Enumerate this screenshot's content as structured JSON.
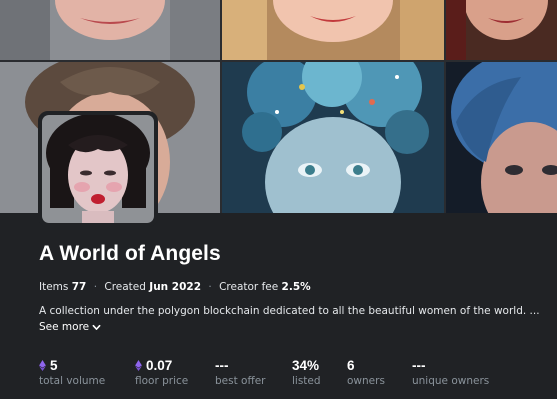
{
  "collection": {
    "title": "A World of Angels",
    "meta": {
      "items_label": "Items",
      "items_value": "77",
      "created_label": "Created",
      "created_value": "Jun 2022",
      "fee_label": "Creator fee",
      "fee_value": "2.5%"
    },
    "description": "A collection under the polygon blockchain dedicated to all the beautiful women of the world. ...",
    "see_more": "See more"
  },
  "stats": [
    {
      "value": "5",
      "label": "total volume",
      "icon": "eth-icon"
    },
    {
      "value": "0.07",
      "label": "floor price",
      "icon": "eth-icon"
    },
    {
      "value": "---",
      "label": "best offer"
    },
    {
      "value": "34%",
      "label": "listed"
    },
    {
      "value": "6",
      "label": "owners"
    },
    {
      "value": "---",
      "label": "unique owners"
    }
  ],
  "colors": {
    "background": "#202225",
    "text_primary": "#ffffff",
    "text_secondary": "#8a939b",
    "eth_purple": "#8f65ee"
  }
}
